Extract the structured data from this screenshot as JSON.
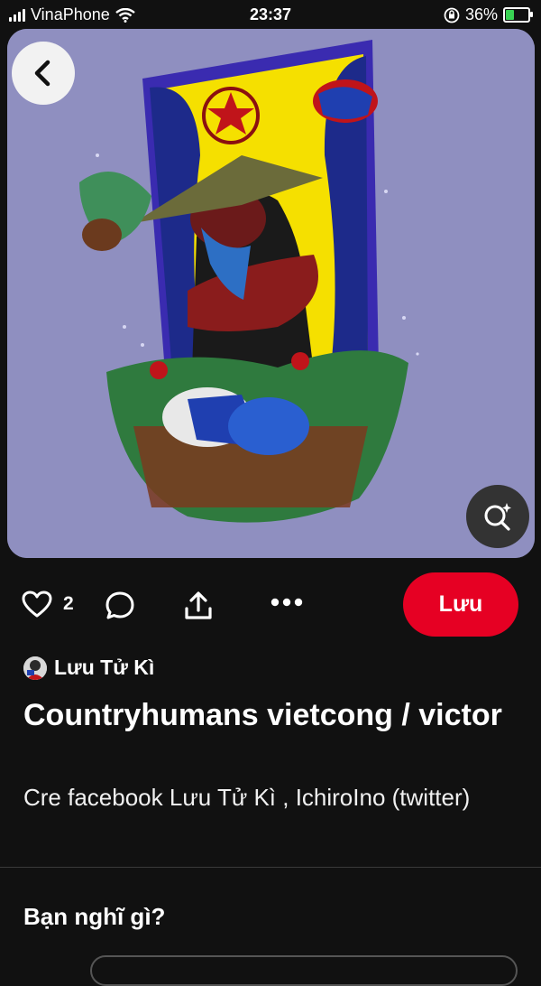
{
  "status_bar": {
    "carrier": "VinaPhone",
    "time": "23:37",
    "battery": "36%"
  },
  "pin": {
    "like_count": "2",
    "save_label": "Lưu",
    "author": "Lưu Tử Kì",
    "title": "Countryhumans vietcong / victor",
    "description": "Cre facebook Lưu Tử Kì , IchiroIno (twitter)"
  },
  "comments": {
    "heading": "Bạn nghĩ gì?"
  },
  "colors": {
    "save_button": "#e60023",
    "background": "#111111",
    "image_backdrop": "#8f8fc0"
  },
  "icons": [
    "signal-icon",
    "wifi-icon",
    "orientation-lock-icon",
    "battery-icon",
    "back-arrow-icon",
    "visual-search-icon",
    "heart-icon",
    "comment-icon",
    "share-icon",
    "more-icon"
  ]
}
